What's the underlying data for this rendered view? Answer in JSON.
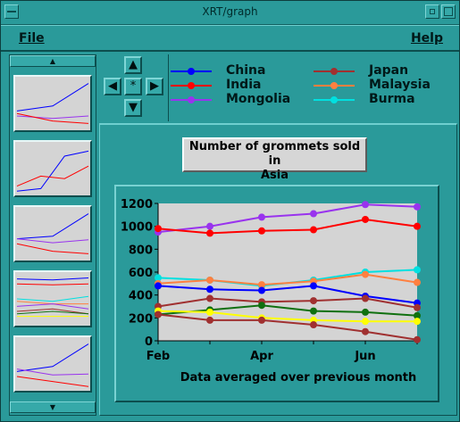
{
  "window": {
    "title": "XRT/graph"
  },
  "menu": {
    "file": "File",
    "help": "Help"
  },
  "nav": {
    "up": "▲",
    "down": "▼",
    "left": "◀",
    "right": "▶",
    "center": "*"
  },
  "sidebar": {
    "scroll_up": "▲",
    "scroll_down": "▼"
  },
  "chart_title": {
    "line1": "Number of grommets sold in",
    "line2": "Asia"
  },
  "colors": {
    "China": "#0000ff",
    "India": "#ff0000",
    "Mongolia": "#9933ee",
    "Japan": "#a03030",
    "Malaysia": "#ff8040",
    "Burma": "#00e0e0",
    "Green": "#107010",
    "Yellow": "#ffff00"
  },
  "legend": [
    {
      "name": "China",
      "color": "#0000ff"
    },
    {
      "name": "India",
      "color": "#ff0000"
    },
    {
      "name": "Mongolia",
      "color": "#9933ee"
    },
    {
      "name": "Japan",
      "color": "#a03030"
    },
    {
      "name": "Malaysia",
      "color": "#ff8040"
    },
    {
      "name": "Burma",
      "color": "#00e0e0"
    }
  ],
  "chart_data": {
    "type": "line",
    "title": "Number of grommets sold in Asia",
    "xlabel": "Data averaged over previous month",
    "ylabel": "",
    "x": [
      1,
      2,
      3,
      4,
      5,
      6
    ],
    "x_ticks": [
      {
        "value": 1,
        "label": "Feb"
      },
      {
        "value": 3,
        "label": "Apr"
      },
      {
        "value": 5,
        "label": "Jun"
      }
    ],
    "xlim": [
      1,
      6
    ],
    "ylim": [
      0,
      1200
    ],
    "y_ticks": [
      0,
      200,
      400,
      600,
      800,
      1000,
      1200
    ],
    "grid": false,
    "series": [
      {
        "name": "Mongolia",
        "color": "#9933ee",
        "values": [
          950,
          1000,
          1080,
          1110,
          1190,
          1170
        ]
      },
      {
        "name": "India",
        "color": "#ff0000",
        "values": [
          980,
          940,
          960,
          970,
          1060,
          1000
        ]
      },
      {
        "name": "Burma",
        "color": "#00e0e0",
        "values": [
          550,
          530,
          480,
          530,
          600,
          620
        ]
      },
      {
        "name": "Malaysia",
        "color": "#ff8040",
        "values": [
          500,
          530,
          490,
          520,
          580,
          510
        ]
      },
      {
        "name": "China",
        "color": "#0000ff",
        "values": [
          480,
          450,
          440,
          480,
          390,
          330
        ]
      },
      {
        "name": "Japan",
        "color": "#a03030",
        "values": [
          300,
          370,
          340,
          350,
          370,
          290
        ]
      },
      {
        "color": "#107010",
        "values": [
          230,
          270,
          310,
          260,
          250,
          220
        ]
      },
      {
        "color": "#ffff00",
        "values": [
          260,
          250,
          200,
          180,
          170,
          170
        ]
      },
      {
        "color": "#a03030",
        "values": [
          230,
          180,
          180,
          140,
          80,
          10
        ]
      }
    ]
  },
  "thumbnails": [
    {
      "series": [
        {
          "color": "#0000ff",
          "values": [
            0.35,
            0.45,
            0.9
          ]
        },
        {
          "color": "#9933ee",
          "values": [
            0.25,
            0.2,
            0.25
          ]
        },
        {
          "color": "#ff0000",
          "values": [
            0.3,
            0.15,
            0.1
          ]
        }
      ]
    },
    {
      "series": [
        {
          "color": "#0000ff",
          "values": [
            0.05,
            0.1,
            0.75,
            0.85
          ]
        },
        {
          "color": "#ff0000",
          "values": [
            0.15,
            0.35,
            0.3,
            0.55
          ]
        }
      ]
    },
    {
      "series": [
        {
          "color": "#0000ff",
          "values": [
            0.4,
            0.45,
            0.9
          ]
        },
        {
          "color": "#9933ee",
          "values": [
            0.4,
            0.32,
            0.38
          ]
        },
        {
          "color": "#ff0000",
          "values": [
            0.3,
            0.15,
            0.1
          ]
        }
      ]
    },
    {
      "series": [
        {
          "color": "#0000ff",
          "values": [
            0.9,
            0.88,
            0.92
          ]
        },
        {
          "color": "#ff0000",
          "values": [
            0.8,
            0.78,
            0.8
          ]
        },
        {
          "color": "#00e0e0",
          "values": [
            0.5,
            0.45,
            0.55
          ]
        },
        {
          "color": "#ff8040",
          "values": [
            0.45,
            0.4,
            0.4
          ]
        },
        {
          "color": "#9933ee",
          "values": [
            0.35,
            0.4,
            0.3
          ]
        },
        {
          "color": "#a03030",
          "values": [
            0.25,
            0.3,
            0.2
          ]
        },
        {
          "color": "#107010",
          "values": [
            0.2,
            0.25,
            0.2
          ]
        },
        {
          "color": "#ffff00",
          "values": [
            0.15,
            0.15,
            0.15
          ]
        }
      ]
    },
    {
      "series": [
        {
          "color": "#0000ff",
          "values": [
            0.35,
            0.45,
            0.9
          ]
        },
        {
          "color": "#9933ee",
          "values": [
            0.4,
            0.28,
            0.3
          ]
        },
        {
          "color": "#ff0000",
          "values": [
            0.25,
            0.15,
            0.05
          ]
        }
      ]
    }
  ]
}
